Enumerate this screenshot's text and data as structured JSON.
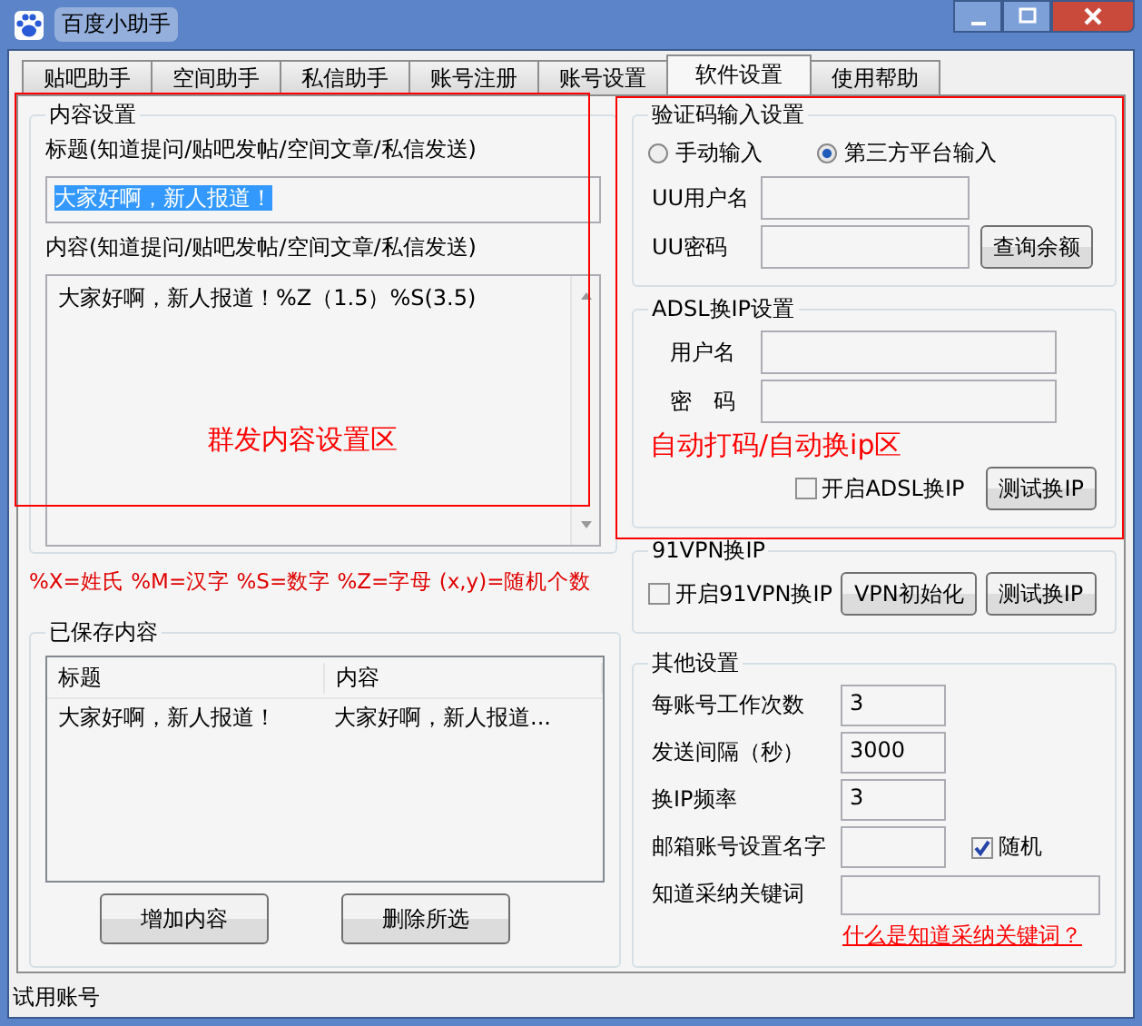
{
  "window": {
    "title": "百度小助手"
  },
  "tabs": [
    {
      "label": "贴吧助手",
      "selected": false
    },
    {
      "label": "空间助手",
      "selected": false
    },
    {
      "label": "私信助手",
      "selected": false
    },
    {
      "label": "账号注册",
      "selected": false
    },
    {
      "label": "账号设置",
      "selected": false
    },
    {
      "label": "软件设置",
      "selected": true
    },
    {
      "label": "使用帮助",
      "selected": false
    }
  ],
  "content_settings": {
    "title": "内容设置",
    "title_label": "标题(知道提问/贴吧发帖/空间文章/私信发送)",
    "title_value": "大家好啊，新人报道！",
    "title_text_selected": true,
    "content_label": "内容(知道提问/贴吧发帖/空间文章/私信发送)",
    "content_value": "大家好啊，新人报道！%Z（1.5）%S(3.5)",
    "hint": "%X=姓氏 %M=汉字 %S=数字 %Z=字母 (x,y)=随机个数"
  },
  "annotations": [
    {
      "text": "群发内容设置区"
    },
    {
      "text": "自动打码/自动换ip区"
    }
  ],
  "captcha": {
    "title": "验证码输入设置",
    "options": [
      {
        "label": "手动输入",
        "selected": false
      },
      {
        "label": "第三方平台输入",
        "selected": true
      }
    ],
    "username_label": "UU用户名",
    "password_label": "UU密码",
    "query_button": "查询余额"
  },
  "adsl": {
    "title": "ADSL换IP设置",
    "username_label": "用户名",
    "password_label": "密　码",
    "enable": {
      "label": "开启ADSL换IP",
      "checked": false
    },
    "test_button": "测试换IP"
  },
  "vpn": {
    "title": "91VPN换IP",
    "enable": {
      "label": "开启91VPN换IP",
      "checked": false
    },
    "init_button": "VPN初始化",
    "test_button": "测试换IP"
  },
  "saved": {
    "title": "已保存内容",
    "columns": [
      "标题",
      "内容"
    ],
    "rows": [
      [
        "大家好啊，新人报道！",
        "大家好啊，新人报道..."
      ]
    ],
    "buttons": [
      "增加内容",
      "删除所选"
    ]
  },
  "other": {
    "title": "其他设置",
    "fields": [
      {
        "kind": "short",
        "label": "每账号工作次数",
        "value": "3"
      },
      {
        "kind": "short",
        "label": "发送间隔（秒）",
        "value": "3000"
      },
      {
        "kind": "short",
        "label": "换IP频率",
        "value": "3"
      },
      {
        "kind": "random",
        "label": "邮箱账号设置名字",
        "checkbox": {
          "label": "随机",
          "checked": true
        }
      },
      {
        "kind": "wide",
        "label": "知道采纳关键词"
      }
    ],
    "link": "什么是知道采纳关键词？"
  },
  "status_bar": "试用账号"
}
